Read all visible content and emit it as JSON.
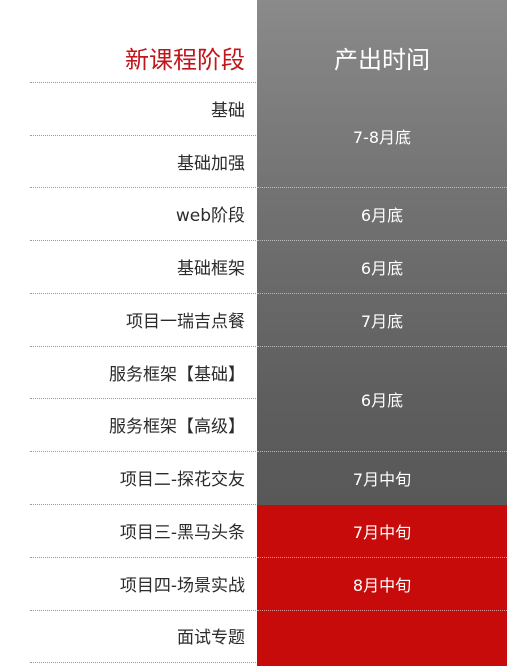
{
  "header": {
    "stage_label": "新课程阶段",
    "time_label": "产出时间"
  },
  "rows": [
    {
      "stage": "基础",
      "time": "7-8月底"
    },
    {
      "stage": "基础加强",
      "time": ""
    },
    {
      "stage": "web阶段",
      "time": "6月底"
    },
    {
      "stage": "基础框架",
      "time": "6月底"
    },
    {
      "stage": "项目一瑞吉点餐",
      "time": "7月底"
    },
    {
      "stage": "服务框架【基础】",
      "time": "6月底"
    },
    {
      "stage": "服务框架【高级】",
      "time": ""
    },
    {
      "stage": "项目二-探花交友",
      "time": "7月中旬"
    },
    {
      "stage": "项目三-黑马头条",
      "time": "7月中旬"
    },
    {
      "stage": "项目四-场景实战",
      "time": "8月中旬"
    },
    {
      "stage": "面试专题",
      "time": ""
    }
  ],
  "colors": {
    "header_red": "#c0161b",
    "highlight_red": "#c70b0b",
    "gray_column": "#6a6a6a"
  }
}
